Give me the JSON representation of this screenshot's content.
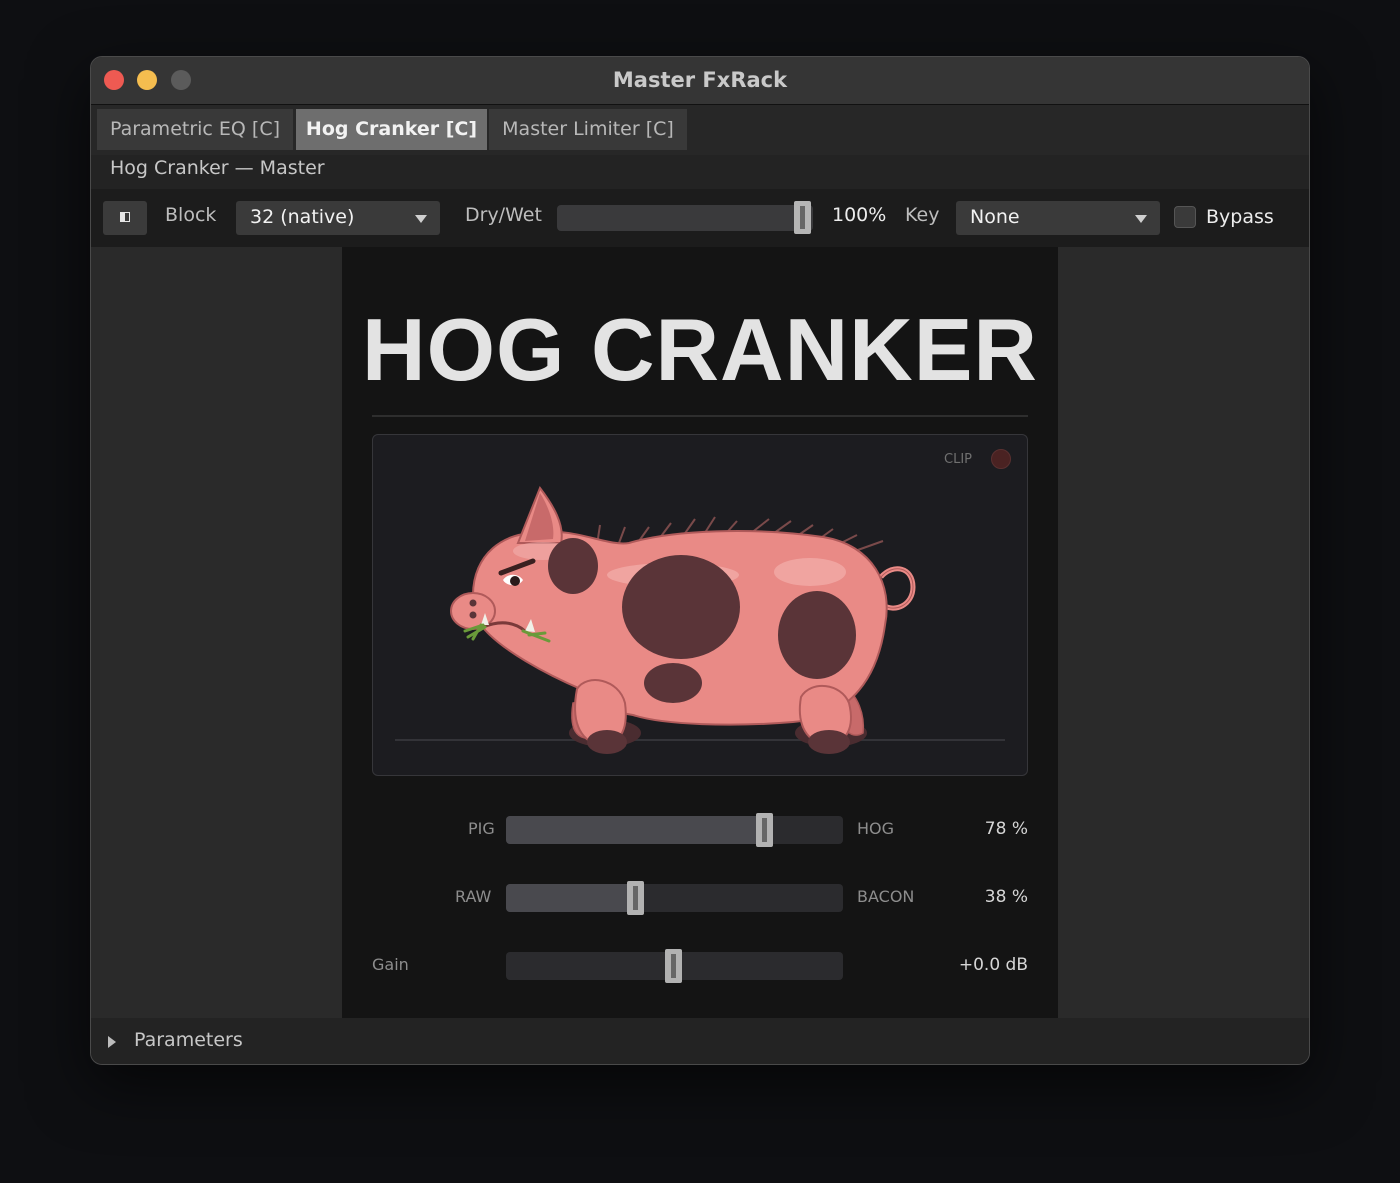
{
  "window": {
    "title": "Master FxRack"
  },
  "tabs": [
    {
      "label": "Parametric EQ [C]"
    },
    {
      "label": "Hog Cranker [C]",
      "active": true
    },
    {
      "label": "Master Limiter [C]"
    }
  ],
  "subtitle": "Hog Cranker — Master",
  "toolbar": {
    "block_label": "Block",
    "block_value": "32 (native)",
    "drywet_label": "Dry/Wet",
    "drywet_value": "100%",
    "drywet_level": 1.0,
    "key_label": "Key",
    "key_value": "None",
    "bypass_label": "Bypass",
    "bypass_checked": false
  },
  "plugin": {
    "title": "HOG CRANKER",
    "clip_label": "CLIP",
    "controls": [
      {
        "left_label": "PIG",
        "right_label": "HOG",
        "value": "78 %",
        "level": 0.78
      },
      {
        "left_label": "RAW",
        "right_label": "BACON",
        "value": "38 %",
        "level": 0.38
      },
      {
        "left_label": "Gain",
        "right_label": "",
        "value": "+0.0 dB",
        "level": 0.5
      }
    ]
  },
  "bottom": {
    "parameters_label": "Parameters"
  },
  "colors": {
    "pig_body": "#e98a86",
    "pig_spot": "#5a3438",
    "pig_outline": "#b05a5a",
    "clip_led": "#4a2222"
  },
  "icons": [
    "sidebar-toggle-icon",
    "chevron-down-icon",
    "disclosure-triangle-icon",
    "clip-led-icon"
  ]
}
